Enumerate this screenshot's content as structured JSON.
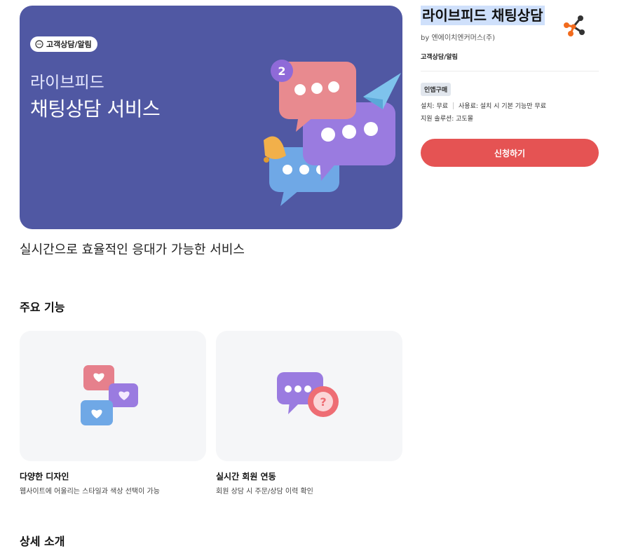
{
  "hero": {
    "badge": "고객상담/알림",
    "subtitle": "라이브피드",
    "title": "채팅상담 서비스",
    "bg_color": "#5058a3",
    "art_badge_number": "2"
  },
  "tagline": "실시간으로 효율적인 응대가 가능한 서비스",
  "features": {
    "section_title": "주요 기능",
    "items": [
      {
        "title": "다양한 디자인",
        "desc": "웹사이트에 어울리는 스타일과 색상 선택이 가능",
        "icon": "hearts-chat-bubbles-icon"
      },
      {
        "title": "실시간 회원 연동",
        "desc": "회원 상담 시 주문/상담 이력 확인",
        "icon": "chat-question-icon"
      }
    ]
  },
  "detail_section_title": "상세 소개",
  "sidebar": {
    "title": "라이브피드 채팅상담",
    "vendor": "by 엔에이치엔커머스(주)",
    "category": "고객상담/알림",
    "purchase_badge": "인앱구매",
    "install": "설치: 무료",
    "usage_fee": "사용료: 설치 시 기본 기능만 무료",
    "solution": "지원 솔루션: 고도몰",
    "apply_button": "신청하기",
    "accent_color": "#e55353"
  }
}
